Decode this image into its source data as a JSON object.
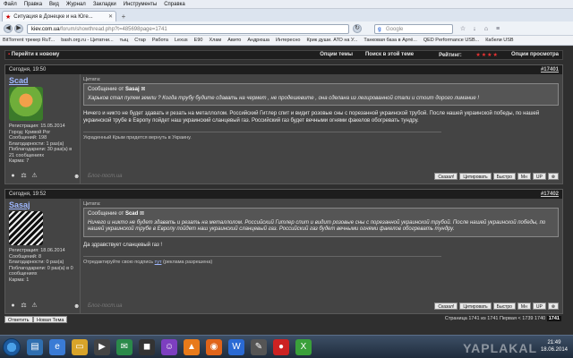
{
  "browser": {
    "menu": [
      "Файл",
      "Правка",
      "Вид",
      "Журнал",
      "Закладки",
      "Инструменты",
      "Справка"
    ],
    "tab_title": "Ситуация в Донецке и на Юге...",
    "new_tab": "+",
    "url_host": "kiev.com.ua",
    "url_path": "/forum/showthread.php?t=485698page=1741",
    "search_placeholder": "Google",
    "search_g": "g",
    "bookmarks": [
      "BitTorrent трекер RuT...",
      "bash.org.ru - Цитатни...",
      "тыц",
      "Стар",
      "Работа",
      "Lexus",
      "E90",
      "Хлам",
      "Авито",
      "Андрюша",
      "Интересно",
      "Крик души. АТО на У...",
      "Танковая база в Артё...",
      "QED Performance USB...",
      "Кабели USB"
    ]
  },
  "forum": {
    "jump_label": "Перейти к новому",
    "options": [
      "Опции темы",
      "Поиск в этой теме",
      "Рейтинг:",
      "Опции просмотра"
    ],
    "rating_stars": "★★★★",
    "posts": [
      {
        "date": "Сегодня, 19:50",
        "number": "#17401",
        "username": "Scad",
        "stats": [
          "Регистрация: 15.05.2014",
          "Город: Кривой Рог",
          "Сообщений: 198",
          "Благодарности: 1 раз(а)",
          "Поблагодарили: 30 раз(а) в",
          "21 сообщениях",
          "Карма: 7"
        ],
        "quote_label": "Цитата:",
        "quote_by_prefix": "Сообщение от",
        "quote_by": "Sasaj",
        "quote_text": "Харьков стал пулем земли ? Когда трубу будите сдавать на чермет , не продешевите , она сделана из легированной стали и стоит дорого лимание !",
        "text": "Ничего и никто не будет здавать и резать на металлолом. Российский Гитлер спит и видит розовые сны с порезанной украинской трубой. После нашей украинской победы, по нашей украинской трубе в Европу пойдет наш украинский сланцевый газ. Российский газ будет вечными огнями факелов обогревать тундру.",
        "signature": "Украденный Крым придется вернуть в Украину.",
        "signature_link": "",
        "signature_suffix": "",
        "watermark": "Блог-пост.ua"
      },
      {
        "date": "Сегодня, 19:52",
        "number": "#17402",
        "username": "Sasaj",
        "stats": [
          "Регистрация: 18.06.2014",
          "Сообщений: 8",
          "Благодарности: 0 раз(а)",
          "Поблагодарили: 0 раз(а) в 0",
          "сообщениях",
          "Карма: 1"
        ],
        "quote_label": "Цитата:",
        "quote_by_prefix": "Сообщение от",
        "quote_by": "Scad",
        "quote_text": "Ничего и никто не будет здавать и резать на металлолом. Российский Гитлер спит и видит розовые сны с порезанной украинской трубой. После нашей украинской победы, по нашей украинской трубе в Европу пойдет наш украинский сланцевый газ. Российский газ будет вечными огнями факелов обогревать тундру.",
        "text": "Да здравствует сланцевый газ !",
        "signature": "Отредактируйте свою подпись",
        "signature_link": "тут",
        "signature_suffix": "(реклама разрешена)",
        "watermark": "Блог-пост.ua"
      }
    ],
    "post_buttons": [
      "Сказал!",
      "Цитировать",
      "Быстро",
      "Мн",
      "UP",
      "⊗"
    ],
    "footer_reply": "Ответить",
    "footer_new": "Новая Тема",
    "pager": "Страница 1741 из 1741  Первая  <  1739  1740",
    "pager_current": "1741"
  },
  "taskbar": {
    "time": "21:49",
    "date": "18.06.2014",
    "watermark": "YAPLAKAL"
  }
}
